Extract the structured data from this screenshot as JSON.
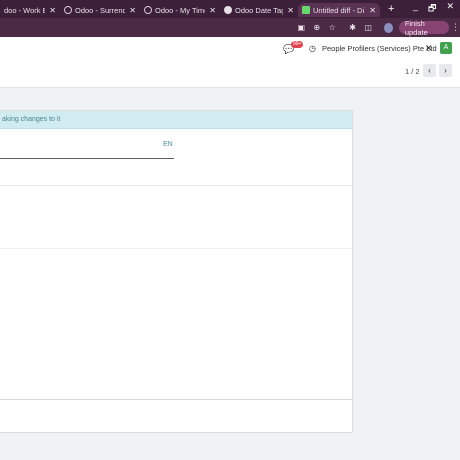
{
  "browser": {
    "tabs": [
      {
        "title": "doo - Work Entri",
        "active": false
      },
      {
        "title": "Odoo - Surrender",
        "active": false
      },
      {
        "title": "Odoo - My Time O",
        "active": false
      },
      {
        "title": "Odoo Date Tag D",
        "active": false
      },
      {
        "title": "Untitled diff - Di",
        "active": true
      }
    ],
    "tab_close": "✕",
    "new_tab": "+",
    "window_controls": [
      "_",
      "🗗",
      "✕"
    ],
    "finish_update_label": "Finish update",
    "kebab": "⋮"
  },
  "navbar": {
    "chat_badge": "99+",
    "company": "People Profilers (Services) Pte Ltd",
    "user_initial": "A"
  },
  "control_panel": {
    "pager": "1 / 2",
    "prev": "‹",
    "next": "›"
  },
  "form": {
    "alert_text": "aking changes to it",
    "lang_code": "EN"
  }
}
